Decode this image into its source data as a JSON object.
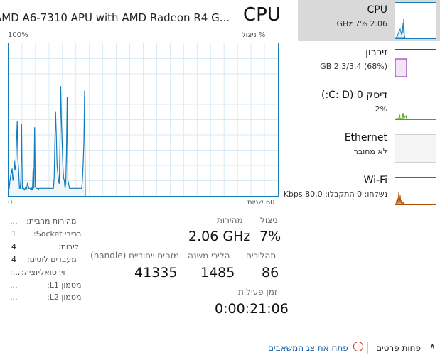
{
  "header": {
    "title": "CPU",
    "model": "AMD A6-7310 APU with AMD Radeon R4 G..."
  },
  "graph": {
    "top_left": "100%",
    "top_right": "% ניצול",
    "bottom_left": "0",
    "bottom_right": "60 שניות",
    "line_color": "#117dbb",
    "fill_color": "#f1f6fa",
    "grid_color": "#d9eaf4",
    "utilization_series": [
      5,
      5,
      10,
      14,
      15,
      18,
      10,
      12,
      23,
      17,
      20,
      35,
      49,
      24,
      16,
      5,
      5,
      10,
      47,
      5,
      5,
      5,
      4,
      5,
      6,
      5,
      8,
      7,
      5,
      5,
      5,
      4,
      5,
      4,
      18,
      5,
      45,
      6,
      5,
      5,
      5,
      4,
      5,
      5,
      5,
      5,
      5,
      5,
      5,
      5,
      5,
      5,
      5,
      5,
      5,
      5,
      5,
      5,
      5,
      5,
      5,
      5,
      5,
      12,
      35,
      55,
      40,
      20,
      15,
      10,
      8,
      30,
      72,
      50,
      35,
      20,
      12,
      10,
      5,
      8,
      28,
      65,
      10,
      8,
      5,
      5,
      5,
      5,
      5,
      5,
      5,
      5,
      5,
      5,
      5,
      5,
      5,
      5,
      5,
      5,
      5,
      5,
      10,
      20,
      35,
      69,
      0
    ]
  },
  "stats": {
    "utilization_label": "ניצול",
    "utilization_value": "7%",
    "speed_label": "מהירות",
    "speed_value": "2.06 GHz",
    "processes_label": "תהליכים",
    "processes_value": "86",
    "threads_label": "הליכי משנה",
    "threads_value": "1485",
    "handles_label": "מזהים ייחודיים (handle)",
    "handles_value": "41335",
    "uptime_label": "זמן פעילות",
    "uptime_value": "0:00:21:06"
  },
  "specs": [
    {
      "label": "מהירות מרבית:",
      "value": "..."
    },
    {
      "label": "רכיבי Socket:",
      "value": "1"
    },
    {
      "label": "ליבות:",
      "value": "4"
    },
    {
      "label": "מעבדים לוגיים:",
      "value": "4"
    },
    {
      "label": "וירטואליזציה:",
      "value": "ז..."
    },
    {
      "label": "מטמון L1:",
      "value": "..."
    },
    {
      "label": "מטמון L2:",
      "value": "..."
    }
  ],
  "sidebar": {
    "items": [
      {
        "title": "CPU",
        "sub": "2.06 GHz  7%",
        "color": "#117dbb"
      },
      {
        "title": "זיכרון",
        "sub": "(68%) 2.3/3.4 GB",
        "color": "#8b12ae"
      },
      {
        "title": "דיסק 0 (C: D:)",
        "sub": "2%",
        "color": "#4da60c"
      },
      {
        "title": "Ethernet",
        "sub": "לא מחובר",
        "color": "#a8a8a8"
      },
      {
        "title": "Wi-Fi",
        "sub": "נשלחו: 0 התקבלו: 80.0 Kbps",
        "color": "#a74f01"
      }
    ]
  },
  "footer": {
    "fewer_details": "פחות פרטים",
    "fewer_icon": "chevron-up-icon",
    "open_monitor": "פתח את צג המשאבים",
    "monitor_icon": "resource-monitor-icon"
  }
}
